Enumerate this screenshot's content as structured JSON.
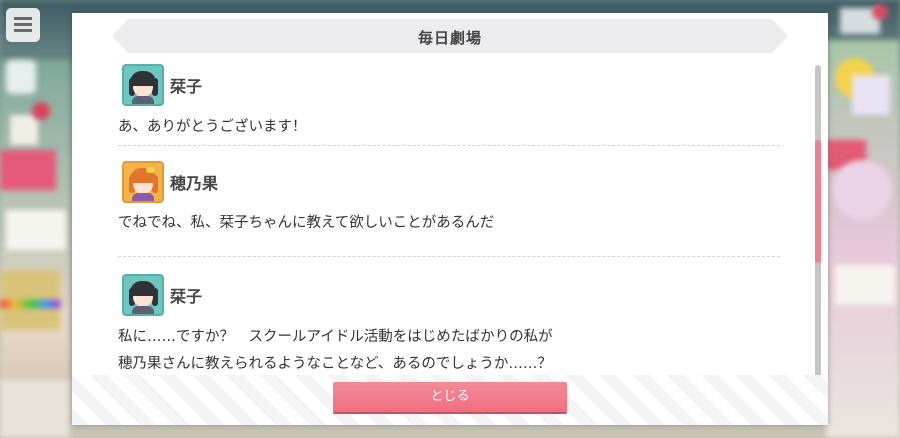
{
  "dialog": {
    "title": "毎日劇場",
    "close_label": "とじる"
  },
  "entries": [
    {
      "speaker": "栞子",
      "avatar": "kotoko-avatar-icon",
      "lines": [
        "あ、ありがとうございます！"
      ]
    },
    {
      "speaker": "穂乃果",
      "avatar": "honoka-avatar-icon",
      "lines": [
        "でねでね、私、栞子ちゃんに教えて欲しいことがあるんだ"
      ]
    },
    {
      "speaker": "栞子",
      "avatar": "kotoko-avatar-icon",
      "lines": [
        "私に……ですか？　スクールアイドル活動をはじめたばかりの私が",
        "穂乃果さんに教えられるようなことなど、あるのでしょうか……？"
      ]
    }
  ],
  "colors": {
    "accent": "#ef7f90",
    "button": "#f07a89",
    "title_bar": "#ececef",
    "text": "#333333"
  },
  "scroll_position": 0.25
}
